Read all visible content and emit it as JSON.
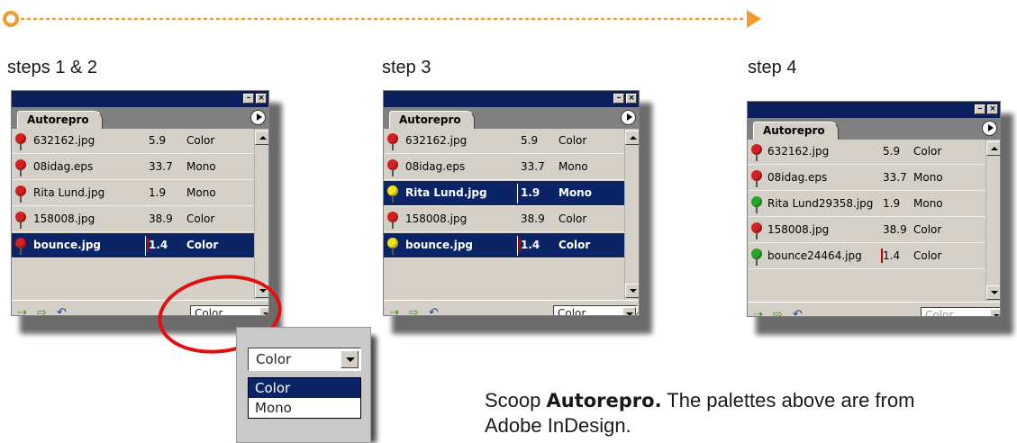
{
  "steps": [
    {
      "title": "steps 1 & 2",
      "tab_label": "Autorepro",
      "rows": [
        {
          "name": "632162.jpg",
          "size": "5.9",
          "mode": "Color",
          "pin": "red",
          "selected": false
        },
        {
          "name": "08idag.eps",
          "size": "33.7",
          "mode": "Mono",
          "pin": "red",
          "selected": false
        },
        {
          "name": "Rita Lund.jpg",
          "size": "1.9",
          "mode": "Mono",
          "pin": "red",
          "selected": false
        },
        {
          "name": "158008.jpg",
          "size": "38.9",
          "mode": "Color",
          "pin": "red",
          "selected": false
        },
        {
          "name": "bounce.jpg",
          "size": "1.4",
          "mode": "Color",
          "pin": "red",
          "selected": true
        }
      ],
      "dropdown_value": "Color"
    },
    {
      "title": "step 3",
      "tab_label": "Autorepro",
      "rows": [
        {
          "name": "632162.jpg",
          "size": "5.9",
          "mode": "Color",
          "pin": "red",
          "selected": false
        },
        {
          "name": "08idag.eps",
          "size": "33.7",
          "mode": "Mono",
          "pin": "red",
          "selected": false
        },
        {
          "name": "Rita Lund.jpg",
          "size": "1.9",
          "mode": "Mono",
          "pin": "yellow",
          "selected": true
        },
        {
          "name": "158008.jpg",
          "size": "38.9",
          "mode": "Color",
          "pin": "red",
          "selected": false
        },
        {
          "name": "bounce.jpg",
          "size": "1.4",
          "mode": "Color",
          "pin": "yellow",
          "selected": true
        }
      ],
      "dropdown_value": "Color"
    },
    {
      "title": "step 4",
      "tab_label": "Autorepro",
      "rows": [
        {
          "name": "632162.jpg",
          "size": "5.9",
          "mode": "Color",
          "pin": "red",
          "selected": false
        },
        {
          "name": "08idag.eps",
          "size": "33.7",
          "mode": "Mono",
          "pin": "red",
          "selected": false
        },
        {
          "name": "Rita Lund29358.jpg",
          "size": "1.9",
          "mode": "Mono",
          "pin": "green",
          "selected": false
        },
        {
          "name": "158008.jpg",
          "size": "38.9",
          "mode": "Color",
          "pin": "red",
          "selected": false
        },
        {
          "name": "bounce24464.jpg",
          "size": "1.4",
          "mode": "Color",
          "pin": "green",
          "selected": false
        }
      ],
      "dropdown_value": "Color"
    }
  ],
  "popup": {
    "value": "Color",
    "options": [
      "Color",
      "Mono"
    ],
    "selected_option": "Color"
  },
  "caption": {
    "prefix": "Scoop ",
    "brand": "Autorepro.",
    "line1_rest": " The palettes above are from",
    "line2": "Adobe InDesign."
  },
  "icons": {
    "window_minimize": "minimize-icon",
    "window_close": "close-icon",
    "palette_menu": "palette-menu-icon",
    "tools": [
      "repro-out-icon",
      "repro-in-icon",
      "undo-icon"
    ]
  },
  "colors": {
    "titlebar": "#0a1f5c",
    "selection": "#0a2466",
    "progress": "#f39a2c",
    "highlight_circle": "#e01010",
    "pin_red": "#d42020",
    "pin_yellow": "#f2e21a",
    "pin_green": "#2aa52a"
  }
}
